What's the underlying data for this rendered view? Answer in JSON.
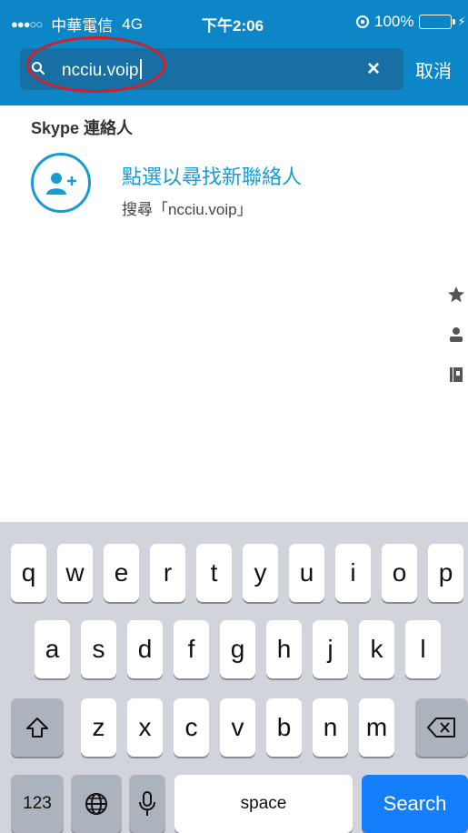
{
  "status_bar": {
    "signal": "●●●○○",
    "carrier": "中華電信",
    "network": "4G",
    "time": "下午2:06",
    "battery_percent": "100%",
    "battery_level": 1.0
  },
  "search": {
    "query": "ncciu.voip",
    "clear_icon": "×",
    "cancel_label": "取消"
  },
  "results": {
    "section_title": "Skype 連絡人",
    "add_contact_title": "點選以尋找新聯絡人",
    "add_contact_subtitle": "搜尋「ncciu.voip」"
  },
  "index_icons": [
    "star-icon",
    "person-icon",
    "address-book-icon"
  ],
  "keyboard": {
    "row1": [
      "q",
      "w",
      "e",
      "r",
      "t",
      "y",
      "u",
      "i",
      "o",
      "p"
    ],
    "row2": [
      "a",
      "s",
      "d",
      "f",
      "g",
      "h",
      "j",
      "k",
      "l"
    ],
    "row3": [
      "z",
      "x",
      "c",
      "v",
      "b",
      "n",
      "m"
    ],
    "numbers_label": "123",
    "space_label": "space",
    "search_label": "Search"
  },
  "colors": {
    "header_bg": "#0c86c6",
    "search_field_bg": "#176fa3",
    "accent": "#179bd7",
    "annotation_red": "#d21f2a",
    "keyboard_bg": "#d1d5db",
    "search_key": "#157efb"
  }
}
